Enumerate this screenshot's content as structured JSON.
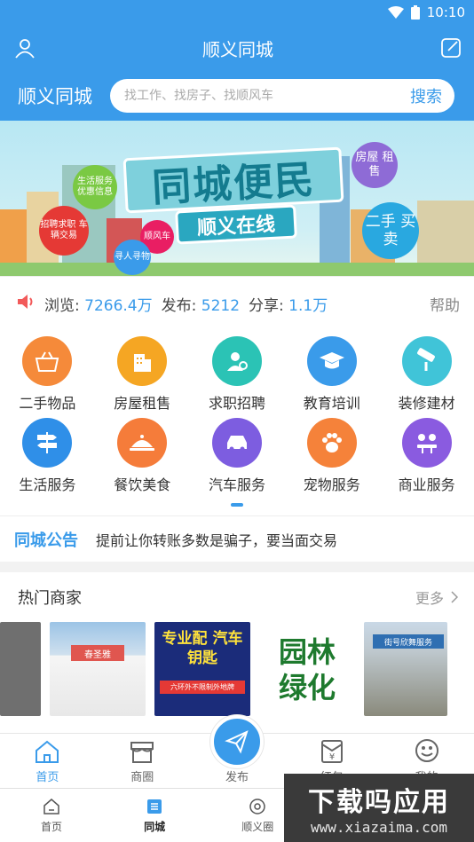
{
  "status": {
    "time": "10:10"
  },
  "titlebar": {
    "title": "顺义同城"
  },
  "search": {
    "city": "顺义同城",
    "placeholder": "找工作、找房子、找顺风车",
    "button": "搜索"
  },
  "banner": {
    "title": "同城便民",
    "subtitle": "顺义在线",
    "bubbles": [
      "生活服务 优惠信息",
      "招聘求职 车辆交易",
      "顺风车",
      "寻人寻物",
      "房屋 租售",
      "二手 买卖"
    ]
  },
  "stats": {
    "browse_label": "浏览:",
    "browse_value": "7266.4万",
    "publish_label": "发布:",
    "publish_value": "5212",
    "share_label": "分享:",
    "share_value": "1.1万",
    "help": "帮助"
  },
  "categories": [
    {
      "label": "二手物品",
      "icon": "basket-icon",
      "color": "#f58a3a"
    },
    {
      "label": "房屋租售",
      "icon": "building-icon",
      "color": "#f5a623"
    },
    {
      "label": "求职招聘",
      "icon": "person-search-icon",
      "color": "#2bc3b5"
    },
    {
      "label": "教育培训",
      "icon": "graduation-cap-icon",
      "color": "#3a9bea"
    },
    {
      "label": "装修建材",
      "icon": "paint-roller-icon",
      "color": "#40c4d8"
    },
    {
      "label": "生活服务",
      "icon": "signpost-icon",
      "color": "#2f8fe8"
    },
    {
      "label": "餐饮美食",
      "icon": "food-tray-icon",
      "color": "#f57c3a"
    },
    {
      "label": "汽车服务",
      "icon": "car-icon",
      "color": "#7d5de0"
    },
    {
      "label": "宠物服务",
      "icon": "paw-icon",
      "color": "#f5823a"
    },
    {
      "label": "商业服务",
      "icon": "meeting-icon",
      "color": "#8a5be0"
    }
  ],
  "notice": {
    "tag": "同城公告",
    "text": "提前让你转账多数是骗子，要当面交易"
  },
  "hot": {
    "title": "热门商家",
    "more": "更多",
    "shops": [
      {
        "text": ""
      },
      {
        "text": "春圣雅"
      },
      {
        "text": "专业配 汽车钥匙",
        "sub": "六环外不限制外地牌"
      },
      {
        "text": "园林 绿化"
      },
      {
        "text": "街号欣舞服务"
      }
    ]
  },
  "bottomnav": {
    "home": "首页",
    "circle": "商圈",
    "publish": "发布",
    "wallet": "红包",
    "mine": "我的"
  },
  "sysnav": {
    "home": "首页",
    "city": "同城",
    "circle": "顺义圈"
  },
  "watermark": {
    "line1": "下载吗应用",
    "line2": "www.xiazaima.com"
  }
}
